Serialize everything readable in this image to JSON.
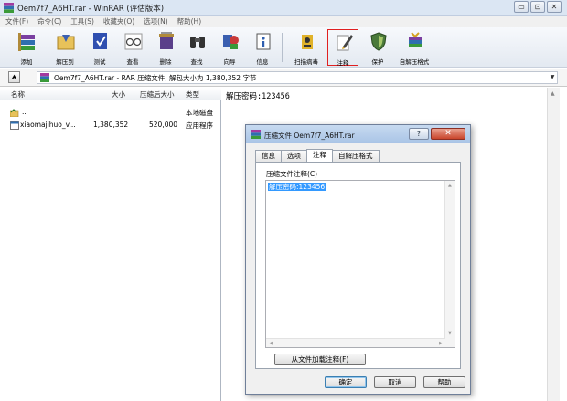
{
  "window": {
    "title": "Oem7f7_A6HT.rar - WinRAR (评估版本)",
    "buttons": [
      "▭",
      "⊡",
      "✕"
    ]
  },
  "menu": [
    "文件(F)",
    "命令(C)",
    "工具(S)",
    "收藏夹(O)",
    "选项(N)",
    "帮助(H)"
  ],
  "toolbar": [
    {
      "name": "add",
      "label": "添加",
      "icon": "books-add-icon",
      "color": "#7a3fa0"
    },
    {
      "name": "extract-to",
      "label": "解压到",
      "icon": "folder-extract-icon",
      "color": "#c9a13a"
    },
    {
      "name": "test",
      "label": "测试",
      "icon": "test-book-icon",
      "color": "#3a4fb0"
    },
    {
      "name": "view",
      "label": "查看",
      "icon": "glasses-view-icon",
      "color": "#6c6c6c"
    },
    {
      "name": "delete",
      "label": "删除",
      "icon": "delete-icon",
      "color": "#8a5a2a"
    },
    {
      "name": "find",
      "label": "查找",
      "icon": "binoculars-icon",
      "color": "#333333"
    },
    {
      "name": "wizard",
      "label": "向导",
      "icon": "wizard-icon",
      "color": "#b03a3a"
    },
    {
      "name": "info",
      "label": "信息",
      "icon": "info-icon",
      "color": "#3a6bb0"
    },
    {
      "name": "virus-scan",
      "label": "扫描病毒",
      "icon": "virus-scan-icon",
      "color": "#c8a020"
    },
    {
      "name": "comment",
      "label": "注释",
      "icon": "comment-pen-icon",
      "color": "#555555",
      "highlight": true
    },
    {
      "name": "protect",
      "label": "保护",
      "icon": "shield-icon",
      "color": "#4a7a3a"
    },
    {
      "name": "sfx",
      "label": "自解压格式",
      "icon": "sfx-icon",
      "color": "#7a3fa0"
    }
  ],
  "address": {
    "up_label": "⮝",
    "path": "Oem7f7_A6HT.rar - RAR 压缩文件, 解包大小为 1,380,352 字节"
  },
  "filelist": {
    "columns": [
      "名称",
      "大小",
      "压缩后大小",
      "类型"
    ],
    "rows": [
      {
        "name": "..",
        "size": "",
        "packed": "",
        "type": "本地磁盘",
        "icon": "parent-folder-icon"
      },
      {
        "name": "xiaomajihuo_v...",
        "size": "1,380,352",
        "packed": "520,000",
        "type": "应用程序",
        "icon": "exe-file-icon"
      }
    ]
  },
  "comment_pane": {
    "text": "解压密码:123456"
  },
  "dialog": {
    "title": "压缩文件 Oem7f7_A6HT.rar",
    "help_label": "?",
    "close_label": "✕",
    "tabs": [
      {
        "label": "信息",
        "active": false
      },
      {
        "label": "选项",
        "active": false
      },
      {
        "label": "注释",
        "active": true
      },
      {
        "label": "自解压格式",
        "active": false
      }
    ],
    "field_label": "压缩文件注释(C)",
    "comment_text": "解压密码:123456",
    "load_button": "从文件加载注释(F)",
    "ok": "确定",
    "cancel": "取消",
    "help": "帮助"
  }
}
